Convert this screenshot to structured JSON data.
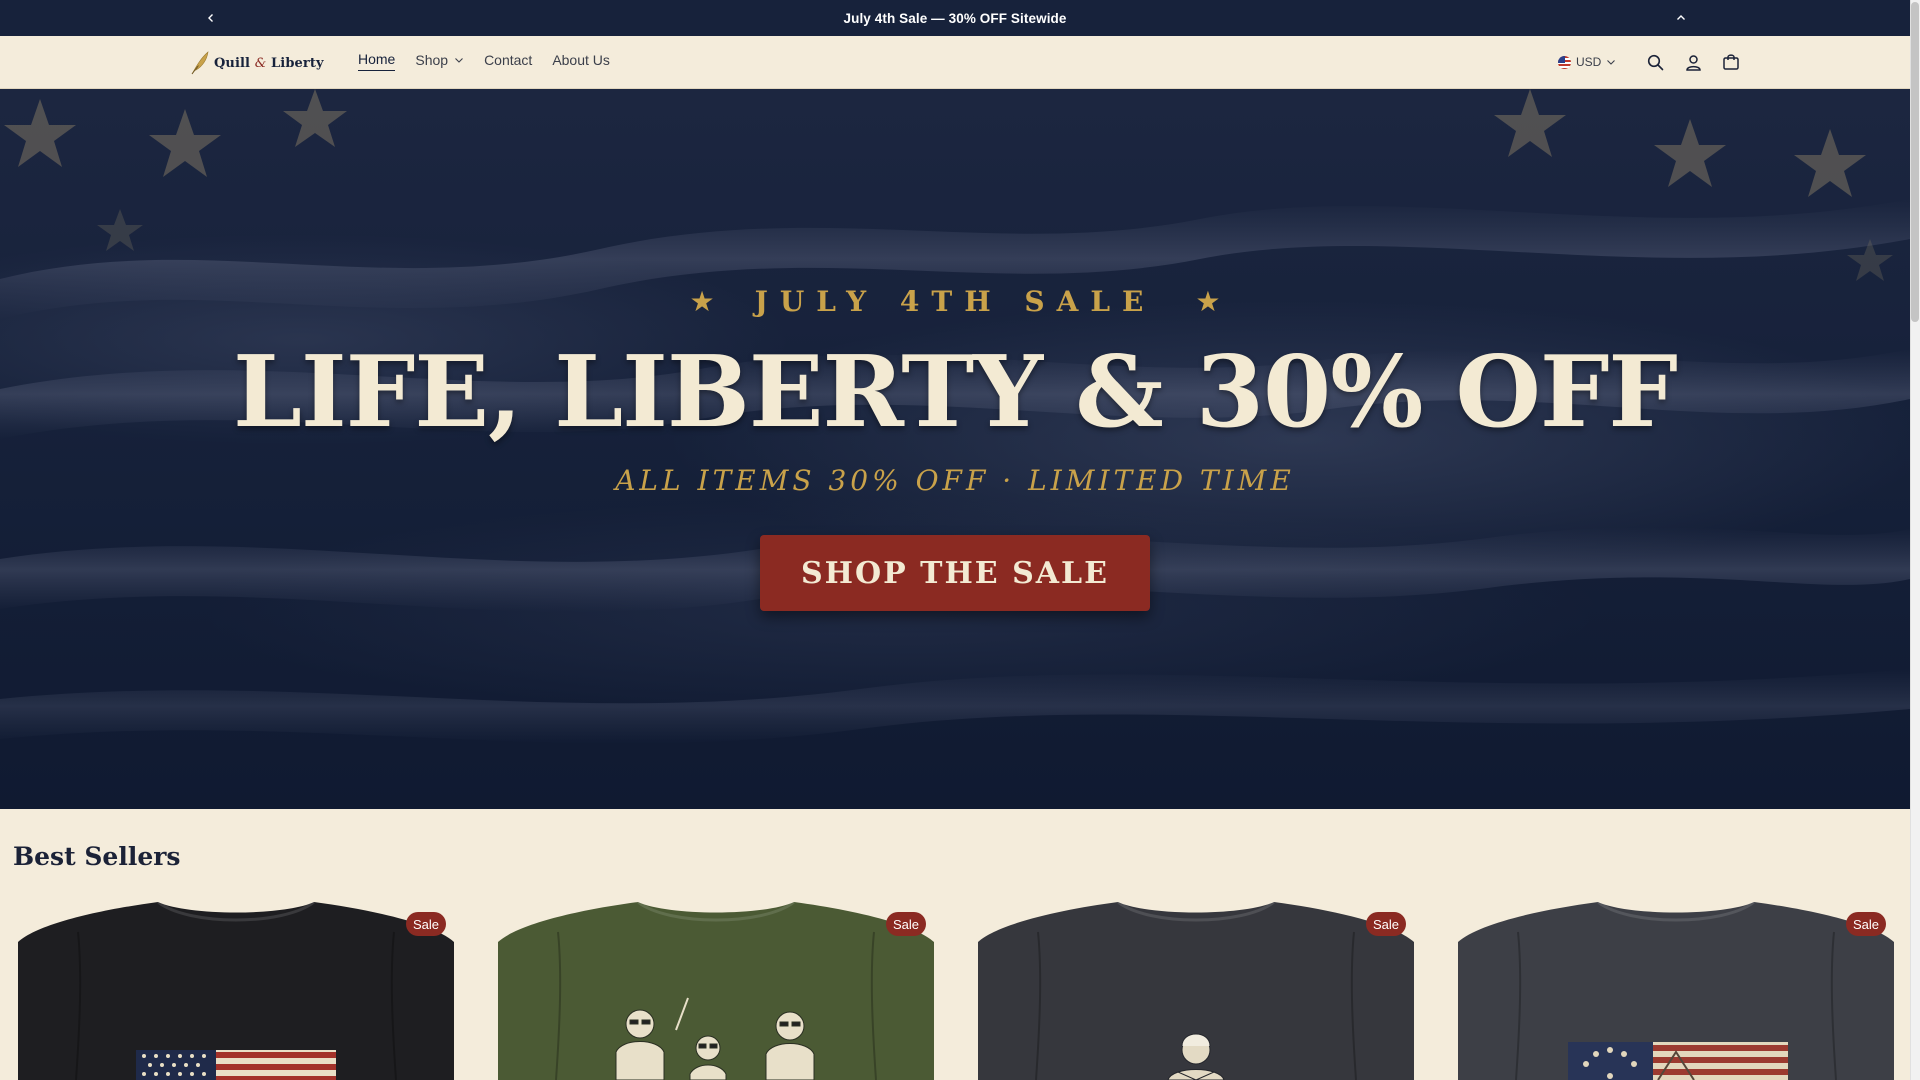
{
  "announcement": {
    "text": "July 4th Sale — 30% OFF Sitewide"
  },
  "header": {
    "logo": {
      "name_part1": "Quill",
      "amp": "&",
      "name_part2": "Liberty"
    },
    "nav": [
      {
        "label": "Home",
        "active": true
      },
      {
        "label": "Shop",
        "has_dropdown": true
      },
      {
        "label": "Contact"
      },
      {
        "label": "About Us"
      }
    ],
    "currency": "USD",
    "icons": [
      "search-icon",
      "account-icon",
      "cart-icon"
    ]
  },
  "hero": {
    "eyebrow": "JULY 4TH SALE",
    "eyebrow_star": "★",
    "headline": "LIFE, LIBERTY & 30% OFF",
    "subline": "ALL ITEMS 30% OFF · LIMITED TIME",
    "cta_label": "SHOP THE SALE"
  },
  "best_sellers": {
    "title": "Best Sellers",
    "products": [
      {
        "badge": "Sale",
        "shirt_color": "#1e1e21",
        "graphic": "american-flag"
      },
      {
        "badge": "Sale",
        "shirt_color": "#4b5a34",
        "graphic": "founding-fathers"
      },
      {
        "badge": "Sale",
        "shirt_color": "#36373d",
        "graphic": "george-washington"
      },
      {
        "badge": "Sale",
        "shirt_color": "#3d3f46",
        "graphic": "betsy-ross-flag"
      }
    ]
  },
  "colors": {
    "navy": "#17223b",
    "cream": "#f4ecdb",
    "gold": "#c9a24a",
    "red": "#8b2a22"
  }
}
